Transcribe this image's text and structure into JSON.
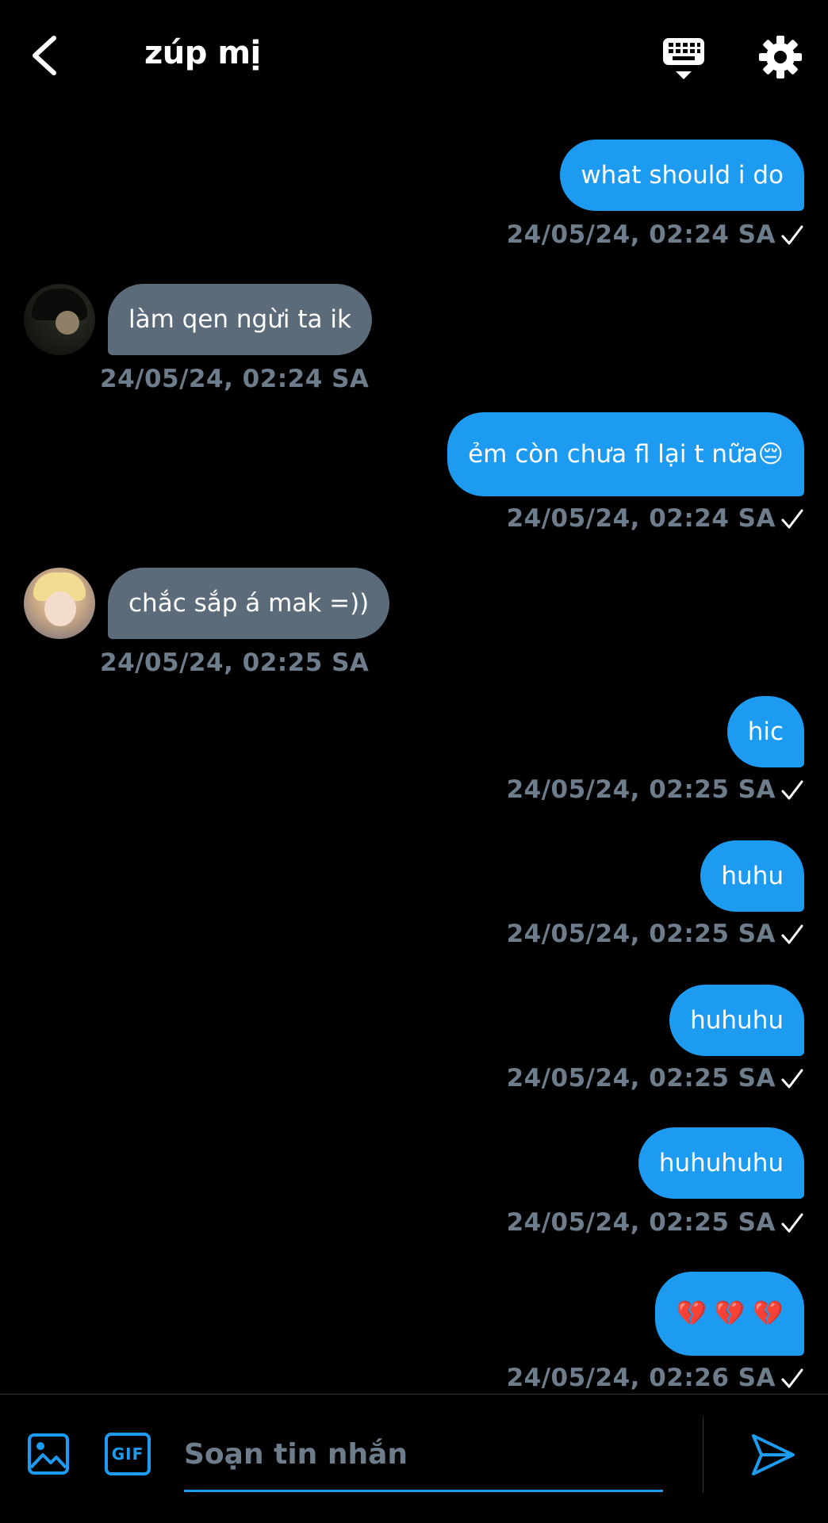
{
  "header": {
    "title": "zúp mị",
    "back_icon": "chevron-left-icon",
    "keyboard_icon": "keyboard-icon",
    "settings_icon": "gear-icon"
  },
  "messages": [
    {
      "direction": "out",
      "text": "what should i do",
      "timestamp": "24/05/24, 02:24 SA",
      "status": "check"
    },
    {
      "direction": "in",
      "text": "làm qen ngừi ta ik",
      "timestamp": "24/05/24, 02:24 SA"
    },
    {
      "direction": "out",
      "text": "ẻm còn chưa fl lại t nữa😔",
      "timestamp": "24/05/24, 02:24 SA",
      "status": "check"
    },
    {
      "direction": "in",
      "text": "chắc sắp á mak =))",
      "timestamp": "24/05/24, 02:25 SA"
    },
    {
      "direction": "out",
      "text": "hic",
      "timestamp": "24/05/24, 02:25 SA",
      "status": "check"
    },
    {
      "direction": "out",
      "text": "huhu",
      "timestamp": "24/05/24, 02:25 SA",
      "status": "check"
    },
    {
      "direction": "out",
      "text": "huhuhu",
      "timestamp": "24/05/24, 02:25 SA",
      "status": "check"
    },
    {
      "direction": "out",
      "text": "huhuhuhu",
      "timestamp": "24/05/24, 02:25 SA",
      "status": "check"
    },
    {
      "direction": "out",
      "text": "💔 💔 💔",
      "timestamp": "24/05/24, 02:26 SA",
      "status": "check"
    }
  ],
  "composer": {
    "placeholder": "Soạn tin nhắn",
    "image_icon": "image-icon",
    "gif_icon": "gif-icon",
    "gif_label": "GIF",
    "send_icon": "send-icon"
  },
  "colors": {
    "accent": "#1d9bf0",
    "incoming_bubble": "#5b6b7a",
    "timestamp": "#6e7d8c",
    "background": "#000000"
  }
}
